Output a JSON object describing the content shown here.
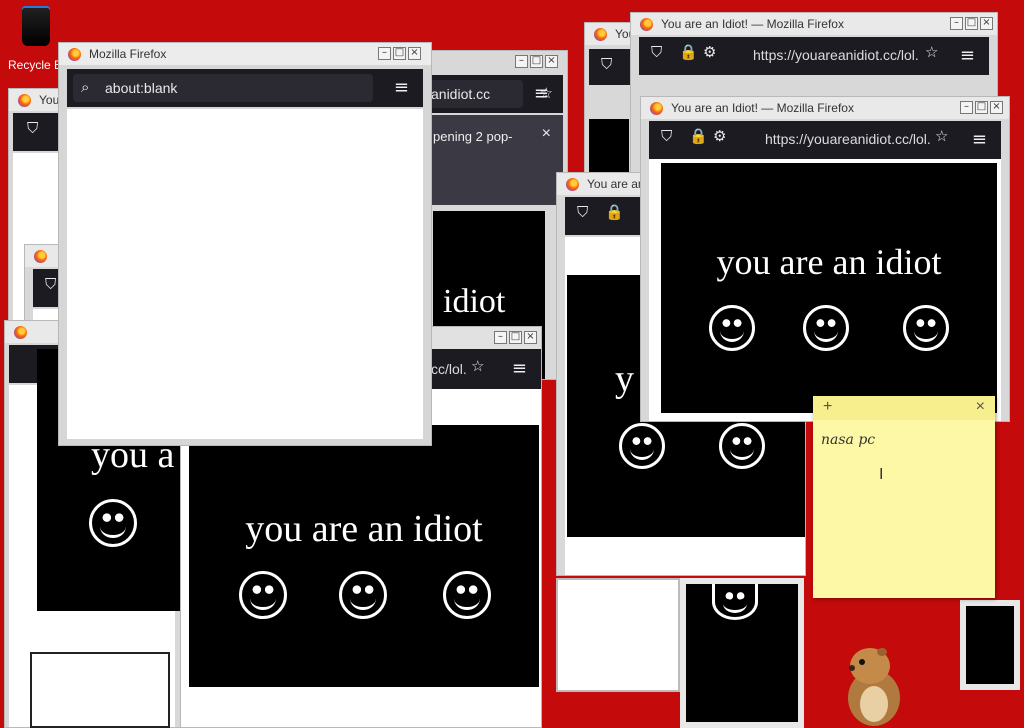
{
  "desktop": {
    "recycle_bin_label": "Recycle B"
  },
  "windows": {
    "idiot_title": "You are an Idiot! — Mozilla Firefox",
    "idiot_title_short": "You",
    "idiot_title_short2": "You are an",
    "blank_title": "Mozilla Firefox",
    "blank_url": "about:blank",
    "url_full": "https://youareanidiot.cc/lol.",
    "url_partial": "anidiot.cc",
    "url_partial2": "cc/lol.",
    "popup_notice": "pening 2 pop-"
  },
  "page": {
    "headline": "you are an idiot",
    "headline_part_a": "idiot",
    "headline_part_b": "you a",
    "headline_part_c": "y"
  },
  "sticky_note": {
    "text": "nasa pc",
    "add_label": "+",
    "close_label": "×"
  },
  "icons": {
    "firefox": "firefox-icon",
    "shield": "shield-icon",
    "lock": "lock-icon",
    "menu": "hamburger-menu-icon",
    "star": "bookmark-star-icon",
    "search": "search-icon"
  }
}
